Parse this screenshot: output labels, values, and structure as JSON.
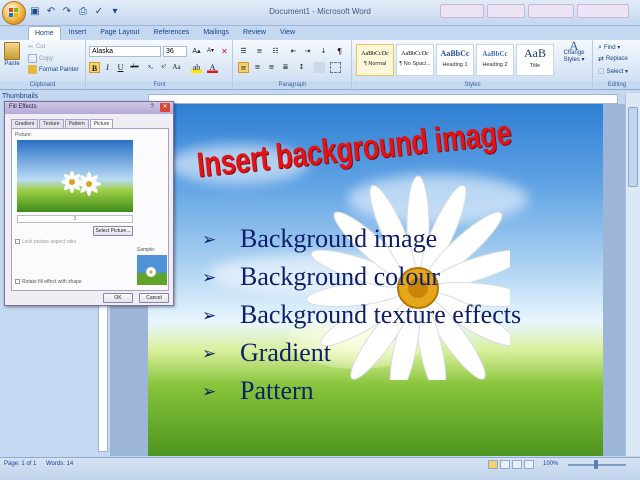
{
  "window": {
    "title": "Document1 - Microsoft Word",
    "taskbar_tabs": [
      "",
      "",
      "",
      ""
    ]
  },
  "ribbon": {
    "tabs": [
      "Home",
      "Insert",
      "Page Layout",
      "References",
      "Mailings",
      "Review",
      "View"
    ],
    "active_tab": "Home",
    "clipboard": {
      "paste": "Paste",
      "cut": "Cut",
      "copy": "Copy",
      "format_painter": "Format Painter",
      "label": "Clipboard"
    },
    "font": {
      "name": "Alaska",
      "size": "36",
      "label": "Font"
    },
    "paragraph": {
      "label": "Paragraph"
    },
    "styles": {
      "label": "Styles",
      "items": [
        {
          "sample": "AaBbCcDc",
          "name": "¶ Normal"
        },
        {
          "sample": "AaBbCcDc",
          "name": "¶ No Spaci..."
        },
        {
          "sample": "AaBbCc",
          "name": "Heading 1"
        },
        {
          "sample": "AaBbCc",
          "name": "Heading 2"
        },
        {
          "sample": "AaB",
          "name": "Title"
        }
      ],
      "change_styles": "Change Styles ▾"
    },
    "editing": {
      "find": "Find ▾",
      "replace": "Replace",
      "select": "Select ▾",
      "label": "Editing"
    }
  },
  "sidebar": {
    "thumbnails_label": "Thumbnails"
  },
  "document": {
    "heading": "Insert background image",
    "bullets": [
      "Background image",
      "Background colour",
      "Background texture effects",
      "Gradient",
      "Pattern"
    ],
    "bullet_glyph": "➢"
  },
  "dialog": {
    "title": "Fill Effects",
    "tabs": [
      "Gradient",
      "Texture",
      "Pattern",
      "Picture"
    ],
    "active_tab": "Picture",
    "picture_label": "Picture:",
    "picture_name": "1",
    "select_button": "Select Picture...",
    "lock_ratio": "Lock picture aspect ratio",
    "sample_label": "Sample:",
    "rotate_label": "Rotate fill effect with shape",
    "ok": "OK",
    "cancel": "Cancel"
  },
  "statusbar": {
    "page": "Page: 1 of 1",
    "words": "Words: 14",
    "zoom": "100%"
  }
}
